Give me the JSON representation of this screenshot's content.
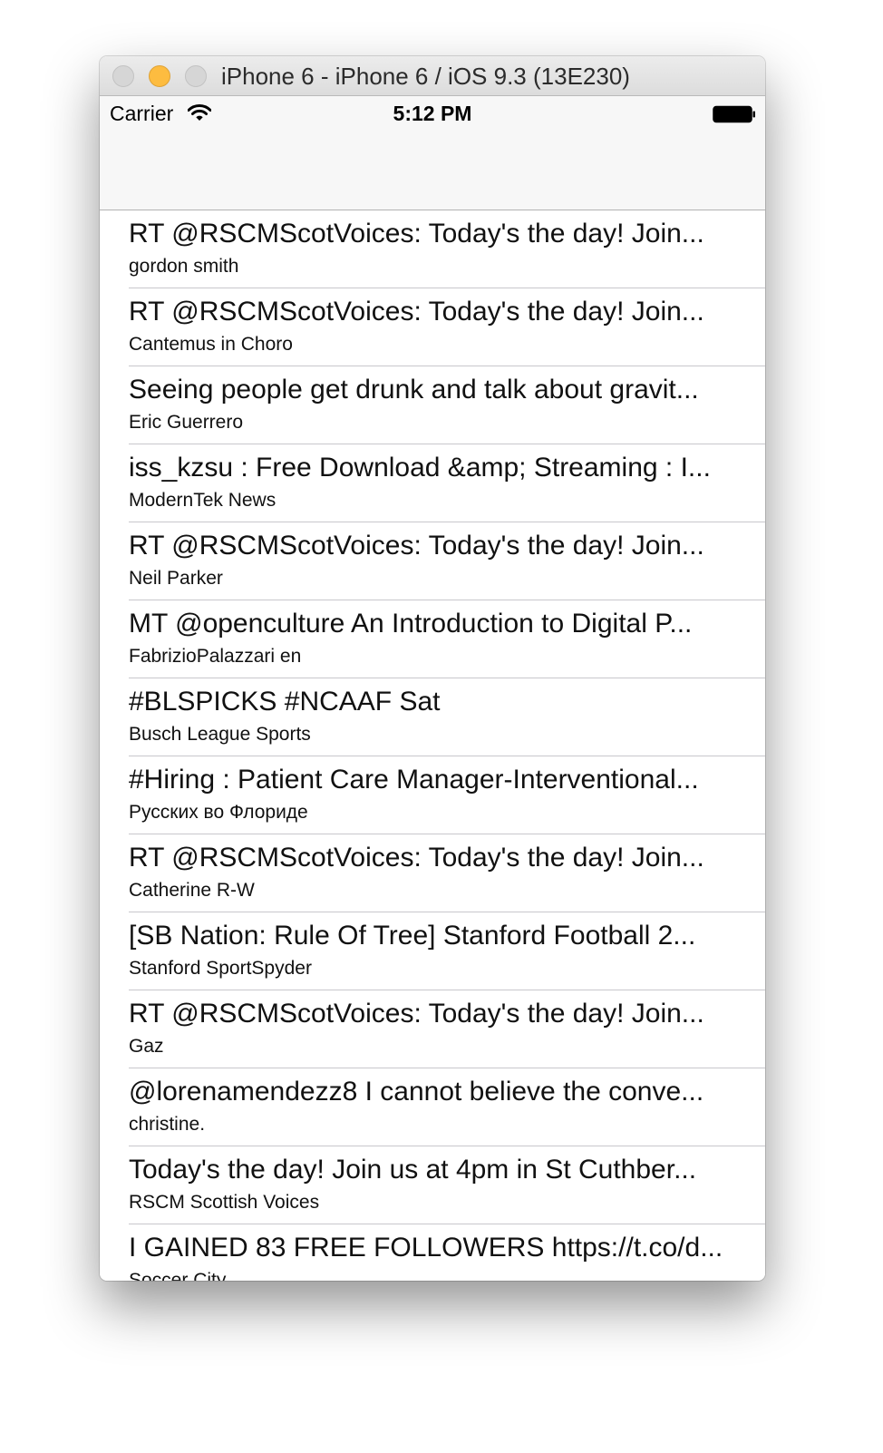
{
  "window": {
    "title": "iPhone 6 - iPhone 6 / iOS 9.3 (13E230)"
  },
  "status_bar": {
    "carrier": "Carrier",
    "time": "5:12 PM"
  },
  "tweets": [
    {
      "text": "RT @RSCMScotVoices: Today's the day! Join...",
      "author": "gordon smith"
    },
    {
      "text": "RT @RSCMScotVoices: Today's the day! Join...",
      "author": "Cantemus in Choro"
    },
    {
      "text": "Seeing people get drunk and talk about gravit...",
      "author": "Eric Guerrero"
    },
    {
      "text": "iss_kzsu : Free Download &amp; Streaming : I...",
      "author": "ModernTek News"
    },
    {
      "text": "RT @RSCMScotVoices: Today's the day! Join...",
      "author": "Neil Parker"
    },
    {
      "text": "MT @openculture An Introduction to Digital P...",
      "author": "FabrizioPalazzari en"
    },
    {
      "text": "#BLSPICKS #NCAAF Sat",
      "author": "Busch League Sports"
    },
    {
      "text": "#Hiring : Patient Care Manager-Interventional...",
      "author": "Русских во Флориде"
    },
    {
      "text": "RT @RSCMScotVoices: Today's the day! Join...",
      "author": "Catherine R-W"
    },
    {
      "text": "[SB Nation: Rule Of Tree] Stanford Football 2...",
      "author": "Stanford SportSpyder"
    },
    {
      "text": "RT @RSCMScotVoices: Today's the day! Join...",
      "author": "Gaz"
    },
    {
      "text": "@lorenamendezz8 I cannot believe the conve...",
      "author": "christine."
    },
    {
      "text": "Today's the day! Join us at 4pm in St Cuthber...",
      "author": "RSCM Scottish Voices"
    },
    {
      "text": "I GAINED 83 FREE FOLLOWERS https://t.co/d...",
      "author": "Soccer City"
    }
  ],
  "icons": {
    "wifi": "wifi-icon",
    "battery": "battery-icon"
  },
  "colors": {
    "minimize_button": "#fdbc40",
    "separator": "#c8c7cc",
    "bar_background": "#f7f7f7"
  }
}
